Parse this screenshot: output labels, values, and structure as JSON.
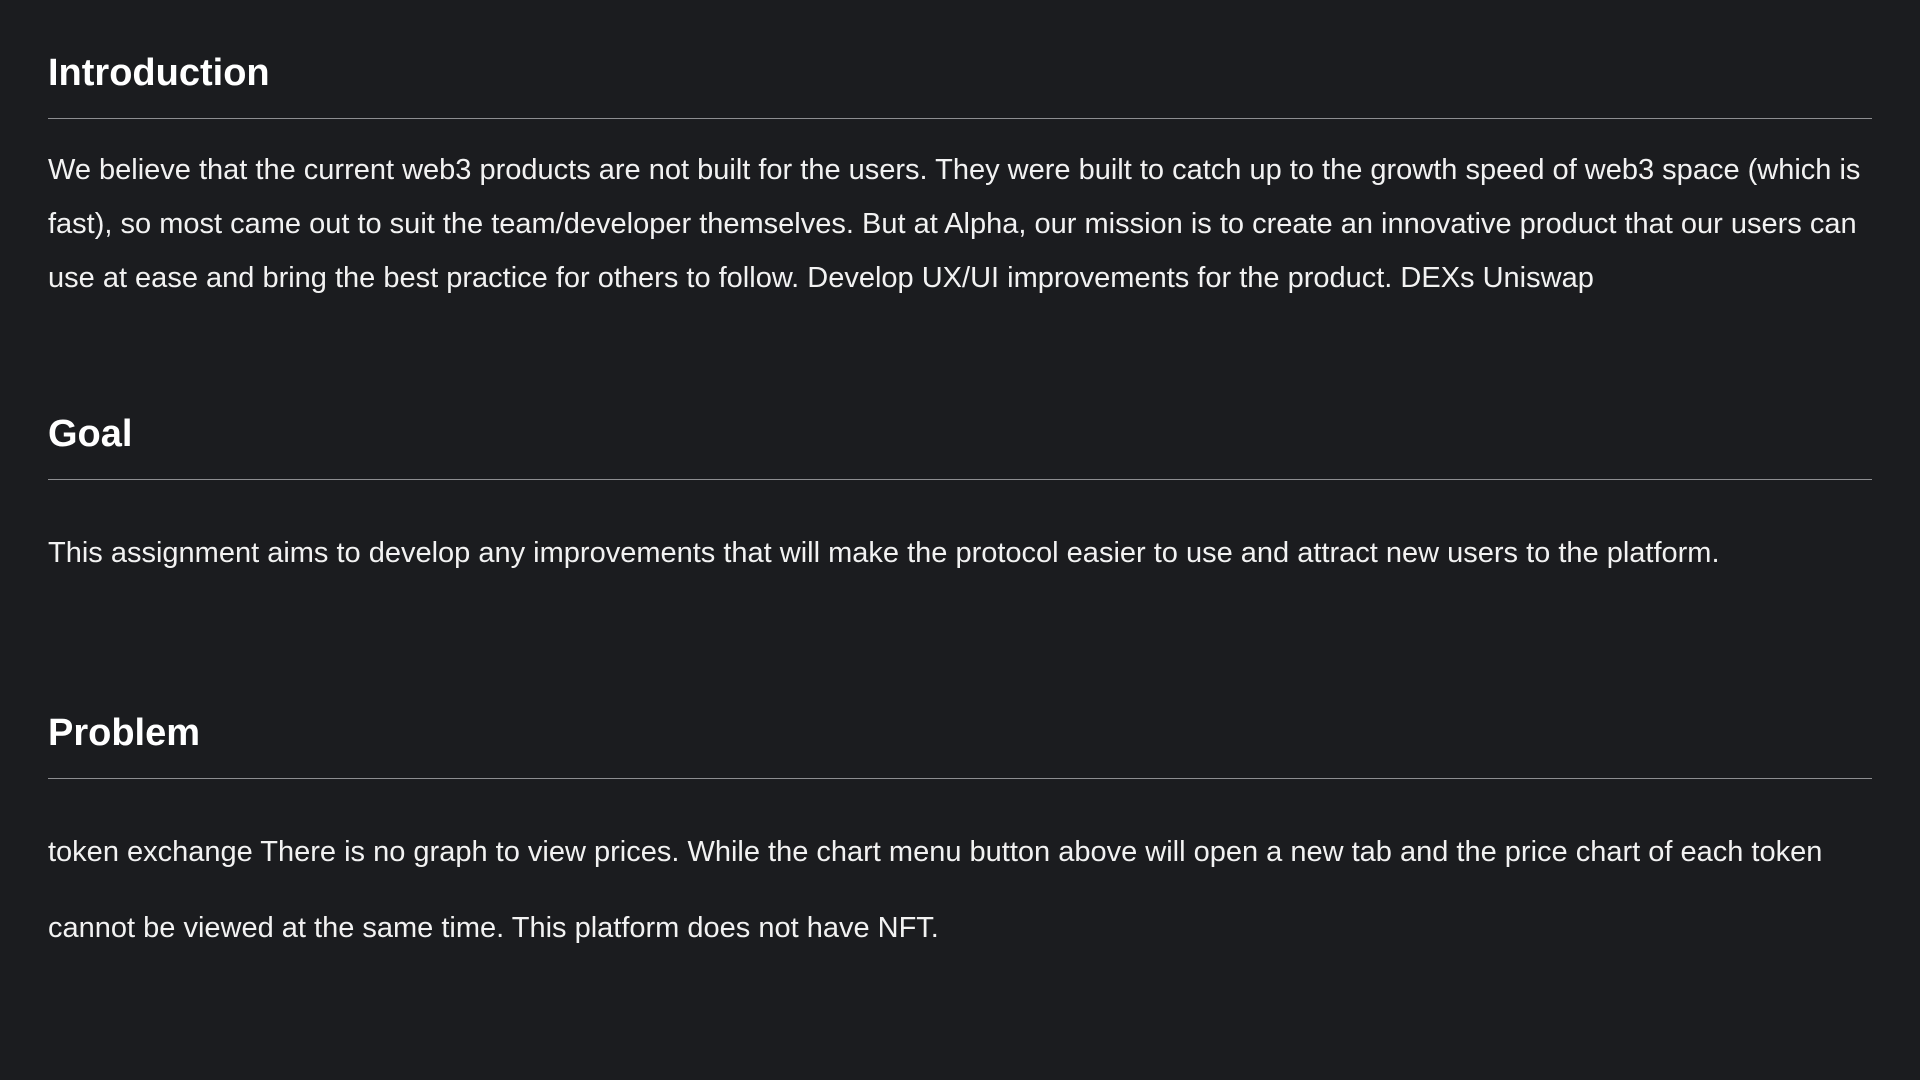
{
  "sections": {
    "introduction": {
      "heading": "Introduction",
      "body": "We believe that the current web3 products are not built for the users. They were built to catch up to the growth speed of web3 space (which is fast), so most came out to suit the team/developer themselves. But at Alpha, our mission is to create an innovative product that our users can use at ease and bring the best practice for others to follow. Develop UX/UI improvements for the product. DEXs Uniswap"
    },
    "goal": {
      "heading": "Goal",
      "body": "This assignment aims to develop any improvements that will make the protocol easier to use and attract new users to the platform."
    },
    "problem": {
      "heading": "Problem",
      "body": "token exchange There is no graph to view prices. While the chart menu button above will open a new tab and the price chart of each token cannot be viewed at the same time. This platform does not have NFT."
    }
  },
  "colors": {
    "background": "#1b1c1f",
    "text": "#f2f2f2",
    "divider": "#8d8e91"
  }
}
